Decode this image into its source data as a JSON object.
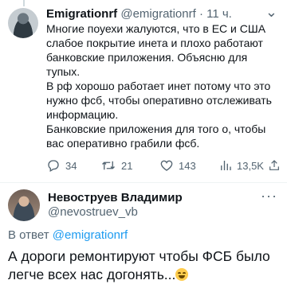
{
  "tweet": {
    "author_name": "Emigrationrf",
    "author_handle": "@emigrationrf",
    "time": "· 11 ч.",
    "more_icon": "chevron-down-icon",
    "paragraphs": [
      "Многие поуехи жалуются, что в ЕС и США слабое покрытие инета и плохо работают банковские приложения. Объясню для тупых.",
      "В рф хорошо работает инет потому что это нужно фсб, чтобы оперативно отслеживать информацию.",
      "Банковские приложения для того о, чтобы вас оперативно грабили фсб."
    ],
    "actions": {
      "replies": "34",
      "retweets": "21",
      "likes": "143",
      "views": "13,5K"
    }
  },
  "reply": {
    "author_name": "Невоструев Владимир",
    "author_handle": "@nevostruev_vb",
    "reply_prefix": "В ответ",
    "reply_mention": "@emigrationrf",
    "text": "А дороги ремонтируют чтобы ФСБ было легче всех нас догонять...",
    "emoji": "rolling-on-floor-laughing-emoji"
  },
  "colors": {
    "text": "#0f1419",
    "secondary": "#536471",
    "accent": "#1d9bf0",
    "divider": "#eff3f4"
  }
}
